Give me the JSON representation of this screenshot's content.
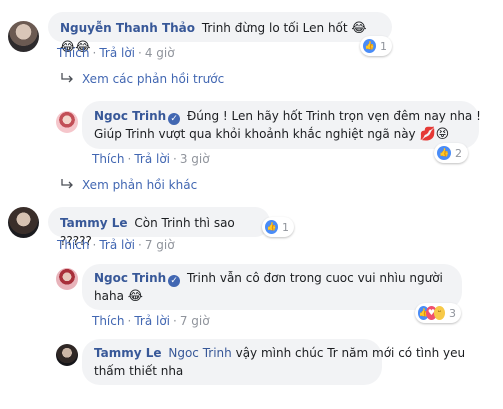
{
  "actions": {
    "like": "Thích",
    "reply": "Trả lời",
    "separator": "·"
  },
  "comments": [
    {
      "author": "Nguyễn Thanh Thảo",
      "text": "Trinh đừng lo tối Len hốt",
      "emoji": "😂😂😂",
      "time": "4 giờ",
      "reaction_count": "1"
    },
    {
      "author": "Ngoc Trinh",
      "line1": "Đúng ! Len hãy hốt Trinh trọn vẹn đêm nay nha !",
      "line2": "Giúp Trinh vượt qua khỏi khoảnh khắc nghiệt ngã này",
      "emoji1": "💋",
      "emoji2": "😝",
      "time": "3 giờ",
      "reaction_count": "2"
    },
    {
      "author": "Tammy Le",
      "text": "Còn Trinh thì sao ?????",
      "time": "7 giờ",
      "reaction_count": "1"
    },
    {
      "author": "Ngoc Trinh",
      "line1": "Trinh vẫn cô đơn trong cuoc vui nhìu người",
      "line2": "haha",
      "emoji": "😂",
      "time": "7 giờ",
      "reaction_count": "3"
    },
    {
      "author": "Tammy Le",
      "mention": "Ngoc Trinh",
      "line1": "vậy mình chúc Tr năm mới có tình yeu",
      "line2": "thấm thiết nha"
    }
  ],
  "links": {
    "previous_replies": "Xem các phản hồi trước",
    "other_replies": "Xem phản hồi khác"
  }
}
